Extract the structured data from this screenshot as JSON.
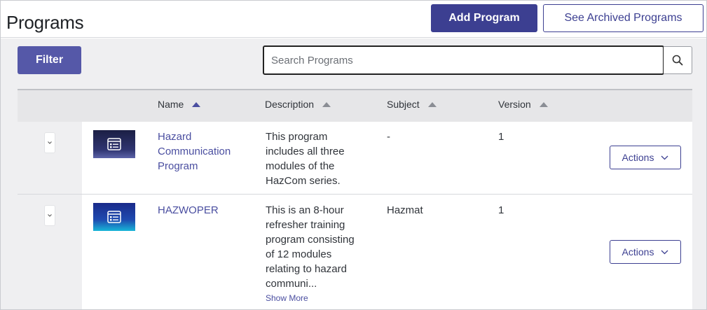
{
  "header": {
    "title": "Programs",
    "add_label": "Add Program",
    "archived_label": "See Archived Programs"
  },
  "toolbar": {
    "filter_label": "Filter",
    "search_placeholder": "Search Programs"
  },
  "table": {
    "columns": [
      "Name",
      "Description",
      "Subject",
      "Version"
    ],
    "rows": [
      {
        "name_lines": [
          "Hazard",
          "Communication",
          "Program"
        ],
        "description_lines": [
          "This program",
          "includes all three",
          "modules of the",
          "HazCom series."
        ],
        "subject": "-",
        "version": "1",
        "actions_label": "Actions"
      },
      {
        "name_lines": [
          "HAZWOPER"
        ],
        "description_lines": [
          "This is an 8-hour",
          "refresher training",
          "program consisting",
          "of 12 modules",
          "relating to hazard",
          "communi..."
        ],
        "show_more": "Show More",
        "subject": "Hazmat",
        "version": "1",
        "actions_label": "Actions"
      }
    ]
  },
  "colors": {
    "primary": "#3c3f91",
    "filter": "#5558a8",
    "link": "#4a4ea0",
    "content_bg": "#efeff1"
  },
  "icons": {
    "search": "search-icon",
    "expand": "chevron-down-icon",
    "thumbnail": "course-list-icon",
    "sort": "sort-ascending-icon"
  }
}
